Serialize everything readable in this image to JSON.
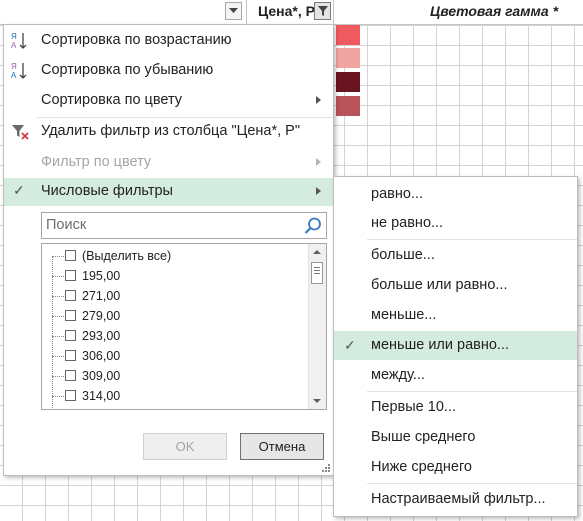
{
  "header": {
    "price_col": "Цена*, Р",
    "color_col": "Цветовая гамма *"
  },
  "colors": {
    "swatches": [
      "#ef5a60",
      "#f2a4a0",
      "#6a1422",
      "#b9535a"
    ],
    "highlight": "#d4ecdf"
  },
  "menu": {
    "sort_asc": "Сортировка по возрастанию",
    "sort_desc": "Сортировка по убыванию",
    "sort_color": "Сортировка по цвету",
    "clear_filter": "Удалить фильтр из столбца \"Цена*, Р\"",
    "filter_color": "Фильтр по цвету",
    "number_filters": "Числовые фильтры"
  },
  "search": {
    "placeholder": "Поиск"
  },
  "list": {
    "select_all": "(Выделить все)",
    "values": [
      "195,00",
      "271,00",
      "279,00",
      "293,00",
      "306,00",
      "309,00",
      "314,00"
    ]
  },
  "buttons": {
    "ok": "OK",
    "cancel": "Отмена"
  },
  "submenu": {
    "items": [
      "равно...",
      "не равно...",
      "больше...",
      "больше или равно...",
      "меньше...",
      "меньше или равно...",
      "между...",
      "Первые 10...",
      "Выше среднего",
      "Ниже среднего",
      "Настраиваемый фильтр..."
    ]
  }
}
